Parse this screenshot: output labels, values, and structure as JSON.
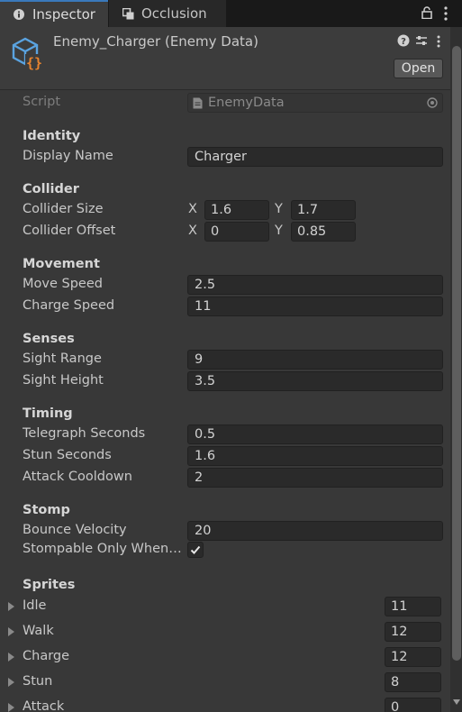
{
  "tabs": [
    {
      "label": "Inspector",
      "icon": "info-icon"
    },
    {
      "label": "Occlusion",
      "icon": "occlusion-icon"
    }
  ],
  "header": {
    "title": "Enemy_Charger (Enemy Data)",
    "open_label": "Open",
    "icon": "scriptable-object-icon"
  },
  "script": {
    "label": "Script",
    "value": "EnemyData"
  },
  "sections": {
    "identity": "Identity",
    "collider": "Collider",
    "movement": "Movement",
    "senses": "Senses",
    "timing": "Timing",
    "stomp": "Stomp",
    "sprites": "Sprites"
  },
  "fields": {
    "display_name": {
      "label": "Display Name",
      "value": "Charger"
    },
    "collider_size": {
      "label": "Collider Size",
      "x_label": "X",
      "x": "1.6",
      "y_label": "Y",
      "y": "1.7"
    },
    "collider_offset": {
      "label": "Collider Offset",
      "x_label": "X",
      "x": "0",
      "y_label": "Y",
      "y": "0.85"
    },
    "move_speed": {
      "label": "Move Speed",
      "value": "2.5"
    },
    "charge_speed": {
      "label": "Charge Speed",
      "value": "11"
    },
    "sight_range": {
      "label": "Sight Range",
      "value": "9"
    },
    "sight_height": {
      "label": "Sight Height",
      "value": "3.5"
    },
    "telegraph_seconds": {
      "label": "Telegraph Seconds",
      "value": "0.5"
    },
    "stun_seconds": {
      "label": "Stun Seconds",
      "value": "1.6"
    },
    "attack_cooldown": {
      "label": "Attack Cooldown",
      "value": "2"
    },
    "bounce_velocity": {
      "label": "Bounce Velocity",
      "value": "20"
    },
    "stompable": {
      "label": "Stompable Only When ...",
      "checked": true
    }
  },
  "sprites": [
    {
      "label": "Idle",
      "count": "11"
    },
    {
      "label": "Walk",
      "count": "12"
    },
    {
      "label": "Charge",
      "count": "12"
    },
    {
      "label": "Stun",
      "count": "8"
    },
    {
      "label": "Attack",
      "count": "0"
    }
  ]
}
